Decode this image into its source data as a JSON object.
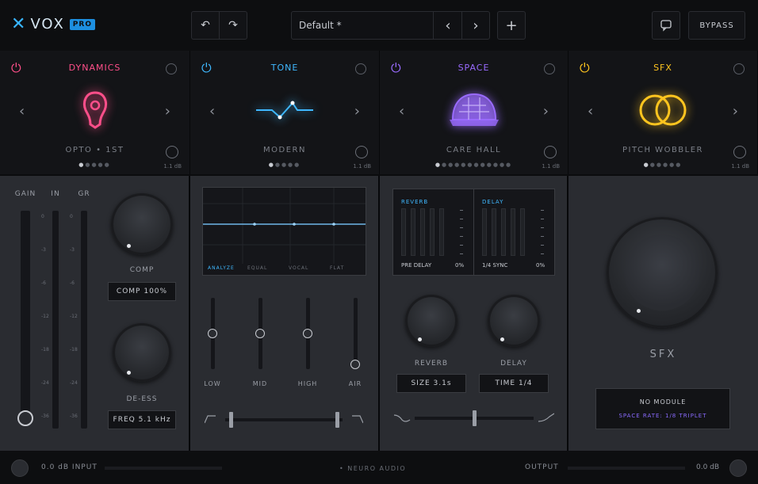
{
  "app": {
    "logo_text": "VOX",
    "logo_badge": "PRO"
  },
  "topbar": {
    "undo_glyph": "↶",
    "redo_glyph": "↷",
    "preset_name": "Default *",
    "prev_glyph": "‹",
    "next_glyph": "›",
    "add_glyph": "+",
    "chat_icon": "speech-bubble-icon",
    "bypass_label": "BYPASS"
  },
  "modules": [
    {
      "title": "DYNAMICS",
      "color": "#ff4f8a",
      "preset": "OPTO • 1ST",
      "value": "1.1 dB",
      "dots": 5,
      "active": 0
    },
    {
      "title": "TONE",
      "color": "#3fb8ff",
      "preset": "MODERN",
      "value": "1.1 dB",
      "dots": 5,
      "active": 0
    },
    {
      "title": "SPACE",
      "color": "#9a6bff",
      "preset": "CARE HALL",
      "value": "1.1 dB",
      "dots": 12,
      "active": 0
    },
    {
      "title": "SFX",
      "color": "#ffc51f",
      "preset": "PITCH WOBBLER",
      "value": "1.1 dB",
      "dots": 6,
      "active": 0
    }
  ],
  "dynamics": {
    "meter_labels": [
      "GAIN",
      "IN",
      "GR"
    ],
    "scale": [
      "0",
      "-3",
      "-6",
      "-12",
      "-18",
      "-24",
      "-36"
    ],
    "comp_label": "COMP",
    "comp_value": "COMP 100%",
    "deess_label": "DE-ESS",
    "deess_value": "FREQ 5.1 kHz",
    "comp_level": 0.55,
    "deess_level": 0.4
  },
  "tone": {
    "eq_tabs": [
      "ANALYZE",
      "EQUAL",
      "VOCAL",
      "FLAT"
    ],
    "bands": [
      {
        "label": "LOW",
        "level": 0.5
      },
      {
        "label": "MID",
        "level": 0.5
      },
      {
        "label": "HIGH",
        "level": 0.5
      },
      {
        "label": "AIR",
        "level": 0.0
      }
    ],
    "filter_low": 0.05,
    "filter_high": 0.95
  },
  "space": {
    "reverb_title": "REVERB",
    "delay_title": "DELAY",
    "reverb_footer": "PRE DELAY",
    "reverb_mix": "0%",
    "delay_footer": "1/4 SYNC",
    "delay_mix": "0%",
    "reverb_label": "REVERB",
    "delay_label": "DELAY",
    "reverb_value": "SIZE 3.1s",
    "delay_value": "TIME 1/4",
    "mix_position": 0.5
  },
  "sfx": {
    "label": "SFX",
    "info_line1": "NO MODULE",
    "info_line2": "SPACE RATE: 1/8 TRIPLET",
    "amount": 0.2
  },
  "bottom": {
    "input_label": "0.0 dB INPUT",
    "center_label": "• NEURO AUDIO",
    "output_label": "OUTPUT",
    "output_value": "0.0 dB"
  }
}
